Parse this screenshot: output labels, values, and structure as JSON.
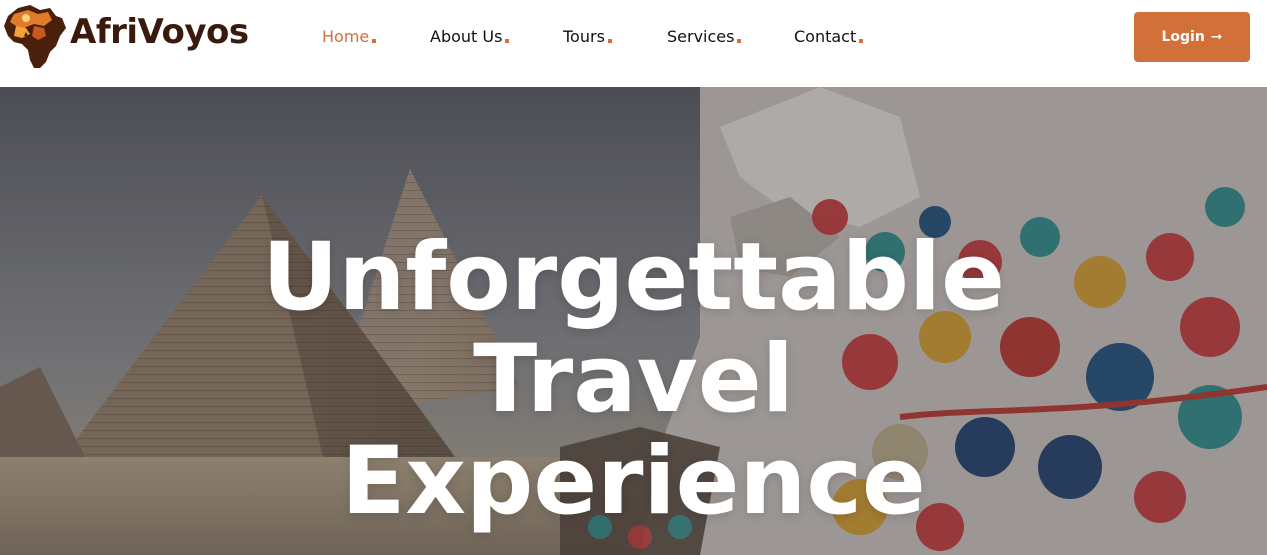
{
  "brand": {
    "name": "AfriVoyos",
    "logo_icon": "africa-map-icon"
  },
  "nav": {
    "items": [
      {
        "label": "Home",
        "active": true
      },
      {
        "label": "About Us",
        "active": false
      },
      {
        "label": "Tours",
        "active": false
      },
      {
        "label": "Services",
        "active": false
      },
      {
        "label": "Contact",
        "active": false
      }
    ]
  },
  "login": {
    "label": "Login",
    "arrow": "➞"
  },
  "hero": {
    "title_lines": [
      "Unforgettable",
      "Travel",
      "Experience"
    ],
    "background": "pyramids-and-camel-photo"
  },
  "colors": {
    "accent": "#d2703a",
    "brand_text": "#3a1a0c",
    "nav_text": "#111111",
    "hero_text": "#ffffff"
  }
}
